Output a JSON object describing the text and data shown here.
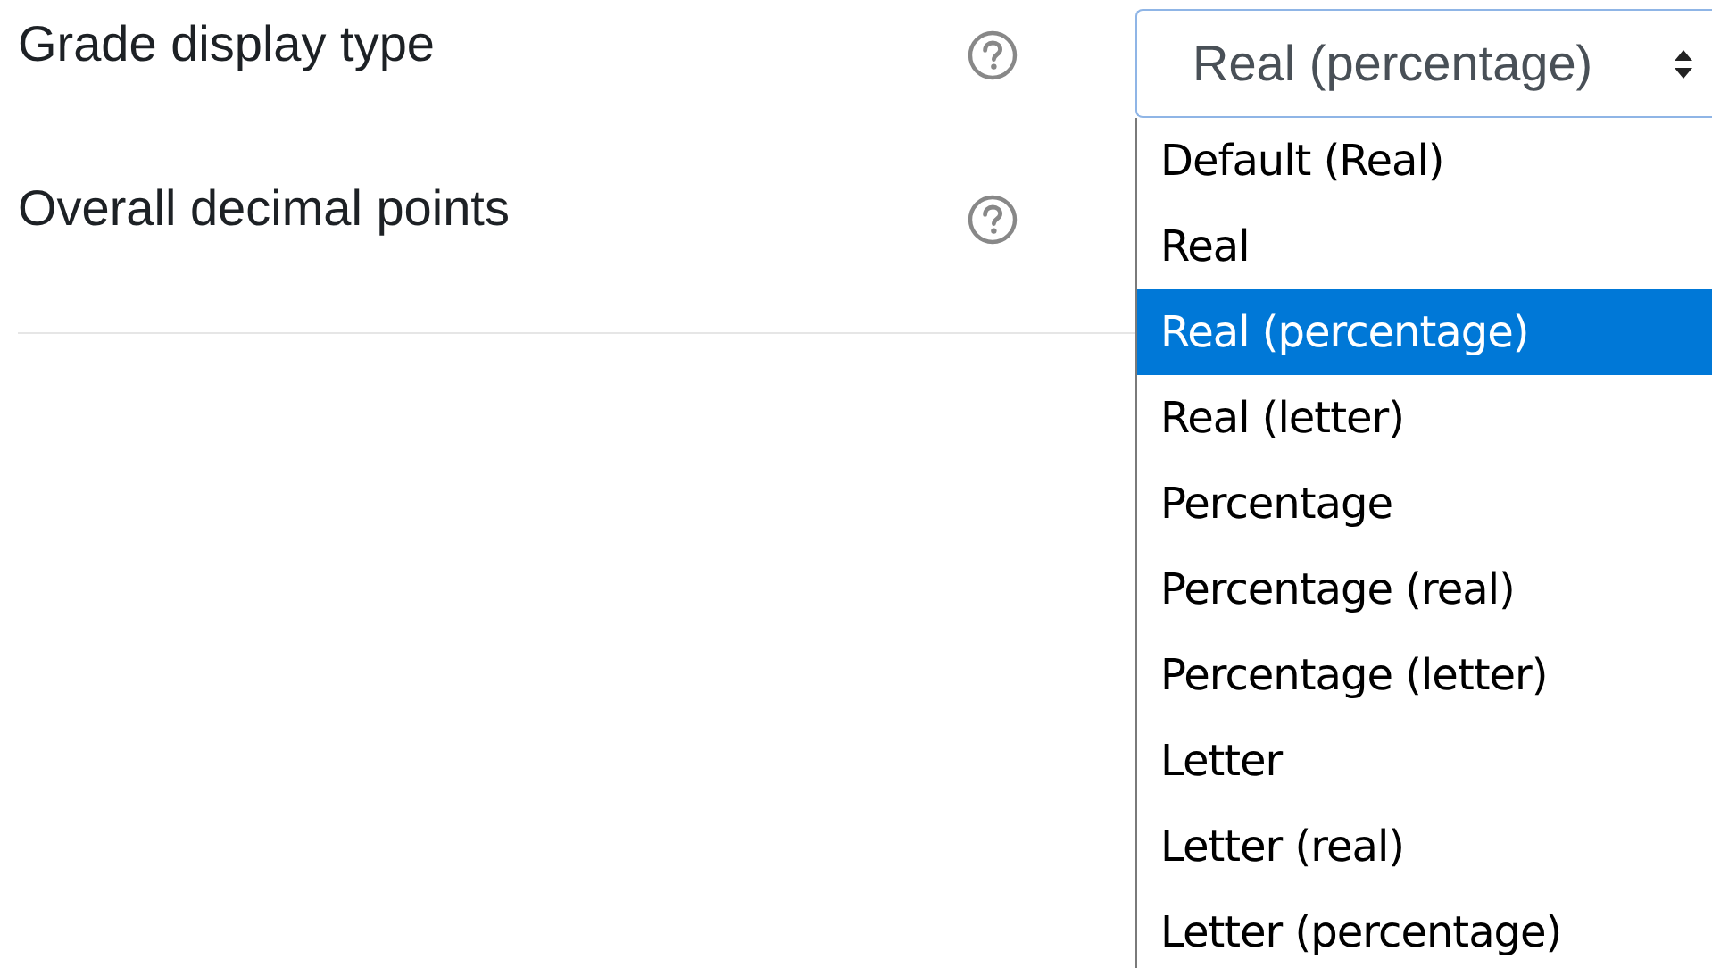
{
  "settings": [
    {
      "label": "Grade display type",
      "has_help": true,
      "select": {
        "value": "Real (percentage)",
        "expanded": true,
        "options": [
          {
            "label": "Default (Real)",
            "selected": false
          },
          {
            "label": "Real",
            "selected": false
          },
          {
            "label": "Real (percentage)",
            "selected": true
          },
          {
            "label": "Real (letter)",
            "selected": false
          },
          {
            "label": "Percentage",
            "selected": false
          },
          {
            "label": "Percentage (real)",
            "selected": false
          },
          {
            "label": "Percentage (letter)",
            "selected": false
          },
          {
            "label": "Letter",
            "selected": false
          },
          {
            "label": "Letter (real)",
            "selected": false
          },
          {
            "label": "Letter (percentage)",
            "selected": false
          }
        ]
      }
    },
    {
      "label": "Overall decimal points",
      "has_help": true
    }
  ]
}
